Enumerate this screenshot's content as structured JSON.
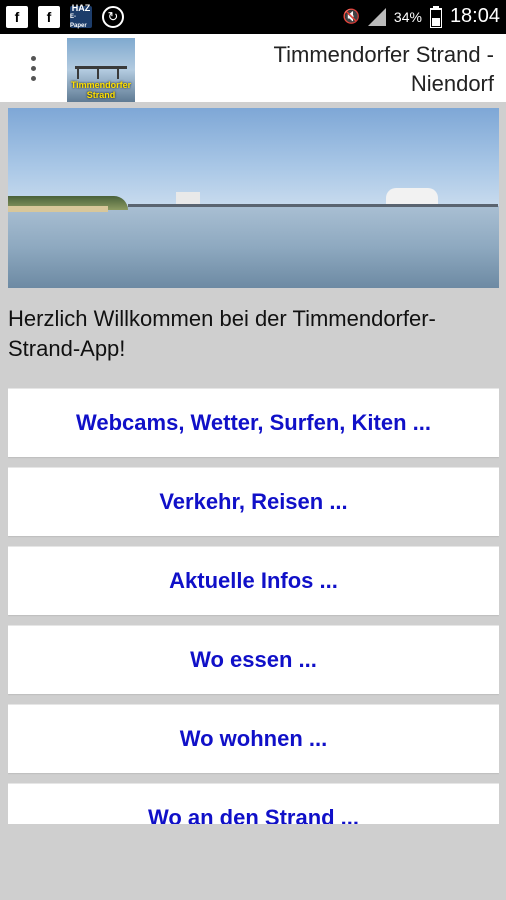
{
  "status_bar": {
    "battery": "34%",
    "time": "18:04",
    "notification_icons": [
      "facebook-icon",
      "facebook-icon",
      "haz-app-icon",
      "sync-icon"
    ],
    "haz_line1": "HAZ",
    "haz_line2": "E-Paper"
  },
  "app_bar": {
    "title": "Timmendorfer Strand - Niendorf",
    "logo_text": "Timmendorfer Strand",
    "menu_icon": "overflow-menu-icon"
  },
  "welcome_text": "Herzlich Willkommen bei der Timmendorfer-Strand-App!",
  "menu_items": [
    {
      "label": "Webcams, Wetter, Surfen, Kiten ..."
    },
    {
      "label": "Verkehr, Reisen ..."
    },
    {
      "label": "Aktuelle Infos ..."
    },
    {
      "label": "Wo essen ..."
    },
    {
      "label": "Wo wohnen ..."
    },
    {
      "label": "Wo an den Strand ..."
    }
  ],
  "colors": {
    "menu_text": "#1010c8",
    "background": "#cfcfcf",
    "status_bar": "#000000"
  }
}
